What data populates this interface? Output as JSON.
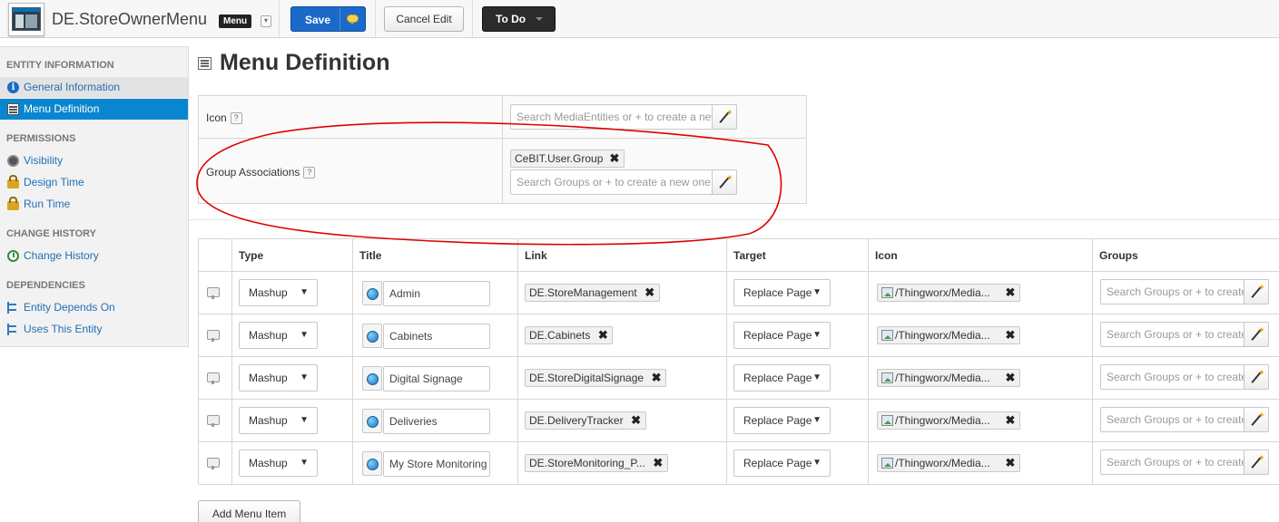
{
  "header": {
    "entity_name": "DE.StoreOwnerMenu",
    "entity_type": "Menu",
    "save_label": "Save",
    "cancel_label": "Cancel Edit",
    "todo_label": "To Do"
  },
  "sidebar": {
    "sections": [
      {
        "title": "ENTITY INFORMATION",
        "items": [
          {
            "label": "General Information",
            "icon": "info-icon"
          },
          {
            "label": "Menu Definition",
            "icon": "menu-icon",
            "active": true
          }
        ]
      },
      {
        "title": "PERMISSIONS",
        "items": [
          {
            "label": "Visibility",
            "icon": "eye-icon"
          },
          {
            "label": "Design Time",
            "icon": "lock-icon"
          },
          {
            "label": "Run Time",
            "icon": "lock-icon"
          }
        ]
      },
      {
        "title": "CHANGE HISTORY",
        "items": [
          {
            "label": "Change History",
            "icon": "history-icon"
          }
        ]
      },
      {
        "title": "DEPENDENCIES",
        "items": [
          {
            "label": "Entity Depends On",
            "icon": "dependency-icon"
          },
          {
            "label": "Uses This Entity",
            "icon": "dependency-icon"
          }
        ]
      }
    ]
  },
  "main": {
    "title": "Menu Definition",
    "icon_field": {
      "label": "Icon",
      "help": "?",
      "placeholder": "Search MediaEntities or + to create a new"
    },
    "groups_field": {
      "label": "Group Associations",
      "help": "?",
      "chip": "CeBIT.User.Group",
      "placeholder": "Search Groups or + to create a new one"
    },
    "table": {
      "columns": [
        "Type",
        "Title",
        "Link",
        "Target",
        "Icon",
        "Groups"
      ],
      "rows": [
        {
          "type": "Mashup",
          "title": "Admin",
          "link": "DE.StoreManagement",
          "target": "Replace Page",
          "icon": "/Thingworx/Media...",
          "groups_placeholder": "Search Groups or + to create"
        },
        {
          "type": "Mashup",
          "title": "Cabinets",
          "link": "DE.Cabinets",
          "target": "Replace Page",
          "icon": "/Thingworx/Media...",
          "groups_placeholder": "Search Groups or + to create"
        },
        {
          "type": "Mashup",
          "title": "Digital Signage",
          "link": "DE.StoreDigitalSignage",
          "target": "Replace Page",
          "icon": "/Thingworx/Media...",
          "groups_placeholder": "Search Groups or + to create"
        },
        {
          "type": "Mashup",
          "title": "Deliveries",
          "link": "DE.DeliveryTracker",
          "target": "Replace Page",
          "icon": "/Thingworx/Media...",
          "groups_placeholder": "Search Groups or + to create"
        },
        {
          "type": "Mashup",
          "title": "My Store Monitoring",
          "link": "DE.StoreMonitoring_P...",
          "target": "Replace Page",
          "icon": "/Thingworx/Media...",
          "groups_placeholder": "Search Groups or + to create"
        }
      ]
    },
    "add_button": "Add Menu Item"
  },
  "colors": {
    "accent": "#0a86d0",
    "save": "#1b6ac9",
    "annotation": "#e00000"
  }
}
